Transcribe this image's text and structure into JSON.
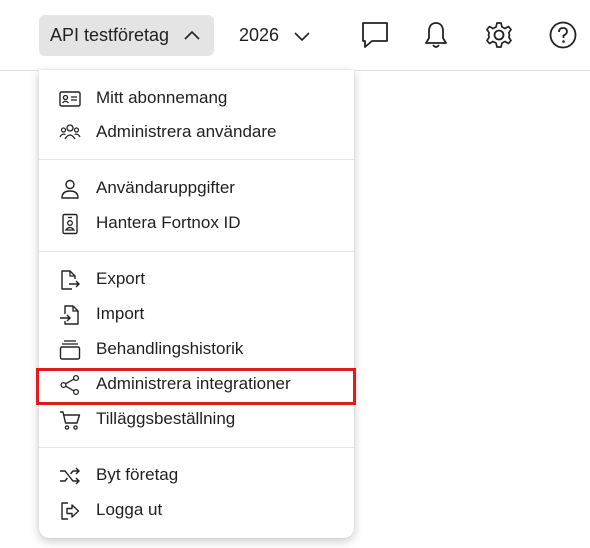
{
  "header": {
    "company_label": "API testföretag",
    "year_label": "2026",
    "icons": [
      "chat-icon",
      "bell-icon",
      "gear-icon",
      "help-icon"
    ]
  },
  "menu": {
    "items": [
      {
        "label": "Mitt abonnemang",
        "icon": "id-card-icon"
      },
      {
        "label": "Administrera användare",
        "icon": "users-icon"
      },
      {
        "label": "Användaruppgifter",
        "icon": "user-icon"
      },
      {
        "label": "Hantera Fortnox ID",
        "icon": "badge-icon"
      },
      {
        "label": "Export",
        "icon": "export-icon"
      },
      {
        "label": "Import",
        "icon": "import-icon"
      },
      {
        "label": "Behandlingshistorik",
        "icon": "stack-icon"
      },
      {
        "label": "Administrera integrationer",
        "icon": "share-icon"
      },
      {
        "label": "Tilläggsbeställning",
        "icon": "cart-icon"
      },
      {
        "label": "Byt företag",
        "icon": "shuffle-icon"
      },
      {
        "label": "Logga ut",
        "icon": "logout-icon"
      }
    ]
  },
  "colors": {
    "highlight": "#e01b1b",
    "button_bg": "#e4e4e4"
  }
}
